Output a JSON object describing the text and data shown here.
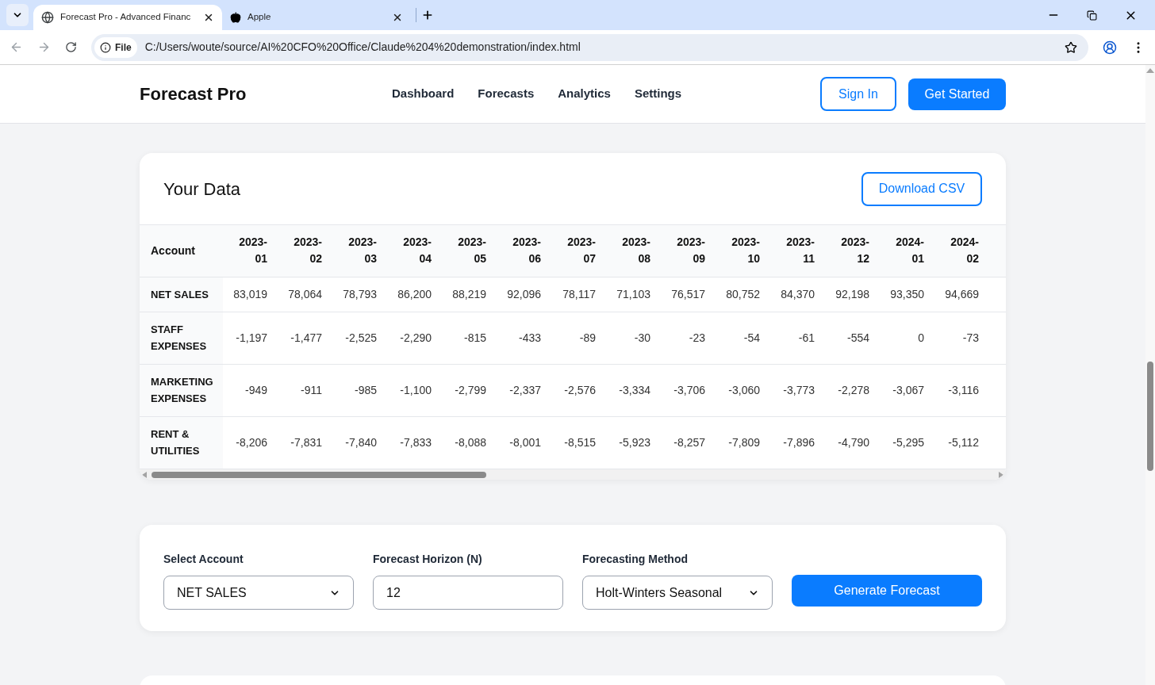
{
  "browser": {
    "tabs": [
      {
        "title": "Forecast Pro - Advanced Financ",
        "selected": true,
        "kind": "globe"
      },
      {
        "title": "Apple",
        "selected": false,
        "kind": "apple"
      }
    ],
    "url_badge": "File",
    "url": "C:/Users/woute/source/AI%20CFO%20Office/Claude%204%20demonstration/index.html"
  },
  "header": {
    "logo": "Forecast Pro",
    "nav": [
      "Dashboard",
      "Forecasts",
      "Analytics",
      "Settings"
    ],
    "sign_in": "Sign In",
    "get_started": "Get Started"
  },
  "data_card": {
    "title": "Your Data",
    "download": "Download CSV",
    "table": {
      "columns": [
        "Account",
        "2023-01",
        "2023-02",
        "2023-03",
        "2023-04",
        "2023-05",
        "2023-06",
        "2023-07",
        "2023-08",
        "2023-09",
        "2023-10",
        "2023-11",
        "2023-12",
        "2024-01",
        "2024-02"
      ],
      "rows": [
        [
          "NET SALES",
          "83,019",
          "78,064",
          "78,793",
          "86,200",
          "88,219",
          "92,096",
          "78,117",
          "71,103",
          "76,517",
          "80,752",
          "84,370",
          "92,198",
          "93,350",
          "94,669"
        ],
        [
          "STAFF EXPENSES",
          "-1,197",
          "-1,477",
          "-2,525",
          "-2,290",
          "-815",
          "-433",
          "-89",
          "-30",
          "-23",
          "-54",
          "-61",
          "-554",
          "0",
          "-73"
        ],
        [
          "MARKETING EXPENSES",
          "-949",
          "-911",
          "-985",
          "-1,100",
          "-2,799",
          "-2,337",
          "-2,576",
          "-3,334",
          "-3,706",
          "-3,060",
          "-3,773",
          "-2,278",
          "-3,067",
          "-3,116"
        ],
        [
          "RENT & UTILITIES",
          "-8,206",
          "-7,831",
          "-7,840",
          "-7,833",
          "-8,088",
          "-8,001",
          "-8,515",
          "-5,923",
          "-8,257",
          "-7,809",
          "-7,896",
          "-4,790",
          "-5,295",
          "-5,112"
        ]
      ]
    }
  },
  "forecast_form": {
    "fields": [
      {
        "label": "Select Account",
        "value": "NET SALES",
        "kind": "select"
      },
      {
        "label": "Forecast Horizon (N)",
        "value": "12",
        "kind": "input"
      },
      {
        "label": "Forecasting Method",
        "value": "Holt-Winters Seasonal",
        "kind": "select"
      }
    ],
    "button": "Generate Forecast"
  }
}
